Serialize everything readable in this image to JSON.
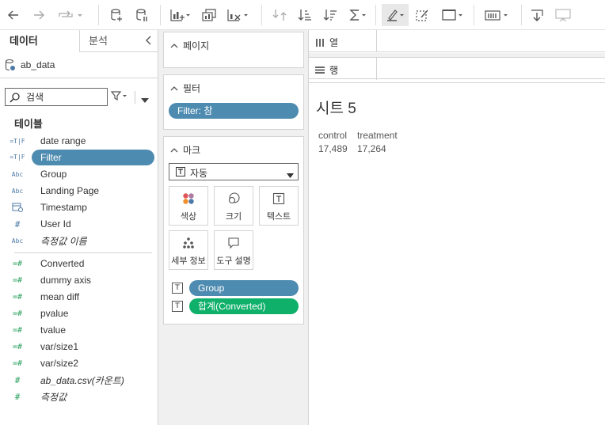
{
  "data_pane": {
    "tabs": {
      "data": "데이터",
      "analysis": "분석"
    },
    "datasource": "ab_data",
    "search": {
      "placeholder": "검색"
    },
    "tables_title": "테이블",
    "dimensions": [
      {
        "type": "=T|F",
        "label": "date range"
      },
      {
        "type": "=T|F",
        "label": "Filter"
      },
      {
        "type": "Abc",
        "label": "Group"
      },
      {
        "type": "Abc",
        "label": "Landing Page"
      },
      {
        "type": "calendar",
        "label": "Timestamp"
      },
      {
        "type": "#",
        "label": "User Id"
      },
      {
        "type": "Abc",
        "label": "측정값 이름"
      }
    ],
    "measures": [
      {
        "type": "=#",
        "label": "Converted"
      },
      {
        "type": "=#",
        "label": "dummy axis"
      },
      {
        "type": "=#",
        "label": "mean diff"
      },
      {
        "type": "=#",
        "label": "pvalue"
      },
      {
        "type": "=#",
        "label": "tvalue"
      },
      {
        "type": "=#",
        "label": "var/size1"
      },
      {
        "type": "=#",
        "label": "var/size2"
      },
      {
        "type": "#",
        "label": "ab_data.csv(카운트)"
      },
      {
        "type": "#",
        "label": "측정값"
      }
    ]
  },
  "cards": {
    "pages": {
      "title": "페이지"
    },
    "filters": {
      "title": "필터",
      "pill": "Filter: 참"
    },
    "marks": {
      "title": "마크",
      "type_value": "자동",
      "buttons": {
        "color": "색상",
        "size": "크기",
        "text": "텍스트",
        "detail": "세부 정보",
        "tooltip": "도구 설명"
      },
      "pills": {
        "group": "Group",
        "sum": "합계(Converted)"
      }
    }
  },
  "shelves": {
    "columns": "열",
    "rows": "행"
  },
  "view": {
    "sheet_title": "시트 5",
    "headers": [
      "control",
      "treatment"
    ],
    "values": [
      "17,489",
      "17,264"
    ]
  },
  "colors": {
    "pill_blue": "#4e8bb0",
    "pill_green": "#0fb06a",
    "accent_icon": "#4e79a7"
  }
}
